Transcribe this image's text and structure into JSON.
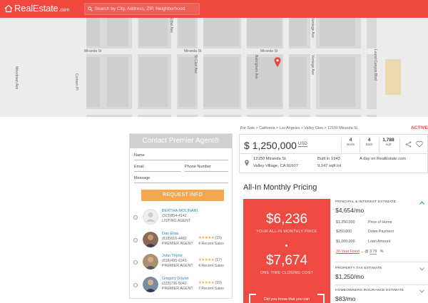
{
  "header": {
    "logo_text": "RealEstate",
    "logo_domain": ".com",
    "search_placeholder": "Search by City, Address, ZIP, Neighborhood.",
    "brand_color": "#f0483e"
  },
  "map": {
    "streets_h": [
      "Miranda St",
      "Miranda St",
      "Miranda St"
    ],
    "streets_v": [
      "Woodman Ave",
      "Corteen Pl",
      "St Clair Ave",
      "Ethel Ave",
      "Babrigham Ave",
      "Vantage Ave",
      "Laurel Canyon Blvd",
      "Vantage Ave"
    ]
  },
  "contact": {
    "title": "Contact Premier Agent®",
    "name_placeholder": "Name",
    "email_placeholder": "Email",
    "phone_placeholder": "Phone Number",
    "message_placeholder": "Message",
    "button_label": "REQUEST INFO",
    "agents": [
      {
        "name": "BERTHA MOLINARI",
        "phone": "(323)854-4142",
        "role": "LISTING AGENT",
        "stars": "",
        "count": "",
        "sales": ""
      },
      {
        "name": "Dan Elias",
        "phone": "(818)616-4482",
        "role": "PREMIER AGENT",
        "stars": "★★★★★",
        "count": "(15)",
        "sales": "4 Recent Sales"
      },
      {
        "name": "John Thyne",
        "phone": "(818)495-6341",
        "role": "PREMIER AGENT",
        "stars": "★★★★★",
        "count": "(17)",
        "sales": "4 Recent Sales"
      },
      {
        "name": "Gregory Doulet",
        "phone": "(323)736-5042",
        "role": "PREMIER AGENT",
        "stars": "★★★★★",
        "count": "(19)",
        "sales": "7 Recent Sales"
      }
    ]
  },
  "listing": {
    "breadcrumb": [
      "For Sale",
      "California",
      "Los Angeles",
      "Valley Glen",
      "12150 Miranda St"
    ],
    "status": "ACTIVE",
    "price": "$ 1,250,000",
    "currency": "USD",
    "beds": "4",
    "beds_label": "Beds",
    "baths": "4",
    "baths_label": "Bath",
    "sqft": "1,788",
    "sqft_label": "sqft",
    "address_line1": "12150 Miranda St",
    "address_line2": "Valley Village, CA 91607",
    "built": "Built in 1943",
    "lot": "9,147 sqft lot",
    "days_on_site": "A day on RealEstate.com"
  },
  "pricing": {
    "title": "All-In Monthly Pricing",
    "monthly_amount": "$6,236",
    "monthly_label": "YOUR ALL-IN MONTHLY PRICE",
    "closing_amount": "$7,674",
    "closing_label": "ONE-TIME CLOSING COST",
    "tip_text": "Did you know that you can",
    "pi_title": "PRINCIPAL & INTEREST ESTIMATE",
    "pi_value": "$4,654/mo",
    "home_price": "$1,250,000",
    "home_price_label": "Price of Home",
    "down_payment": "$250,000",
    "down_payment_label": "Down Payment",
    "loan_amount": "$1,000,000",
    "loan_amount_label": "Loan Amount",
    "loan_type": "30-Year Fixed",
    "rate_prefix": "@",
    "rate": "3.79",
    "rate_unit": "%",
    "tax_title": "PROPERTY TAX ESTIMATE",
    "tax_value": "$1,250/mo",
    "ins_title": "HOMEOWNERS INSURANCE ESTIMATE",
    "ins_value": "$83/mo"
  }
}
